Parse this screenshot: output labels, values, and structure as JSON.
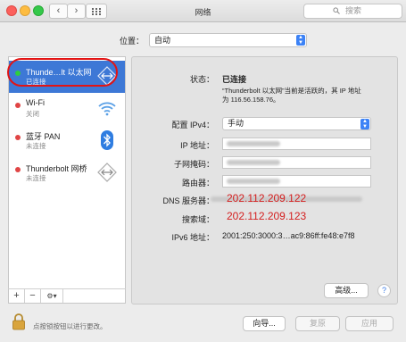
{
  "window": {
    "title": "网络"
  },
  "toolbar": {
    "back_glyph": "‹",
    "forward_glyph": "›",
    "search_placeholder": "搜索",
    "search_icon_glyph": "🔍"
  },
  "location": {
    "label": "位置：",
    "value": "自动"
  },
  "services": [
    {
      "name": "Thunde…lt 以太网",
      "status": "已连接",
      "dot_color": "#2ecc40",
      "icon": "ethernet-icon",
      "selected": true
    },
    {
      "name": "Wi-Fi",
      "status": "关闭",
      "dot_color": "#e04545",
      "icon": "wifi-icon",
      "selected": false
    },
    {
      "name": "蓝牙 PAN",
      "status": "未连接",
      "dot_color": "#e04545",
      "icon": "bluetooth-icon",
      "selected": false
    },
    {
      "name": "Thunderbolt 网桥",
      "status": "未连接",
      "dot_color": "#e04545",
      "icon": "ethernet-icon",
      "selected": false
    }
  ],
  "sidebar_actions": {
    "add": "+",
    "remove": "−",
    "gear": "⚙▾"
  },
  "detail": {
    "status_label": "状态：",
    "status_value": "已连接",
    "status_desc_1": "“Thunderbolt 以太网”当前是活跃的，其 IP 地址",
    "status_desc_2": "为 116.56.158.76。",
    "config_label": "配置 IPv4：",
    "config_value": "手动",
    "ip_label": "IP 地址：",
    "subnet_label": "子网掩码：",
    "router_label": "路由器：",
    "dns_label": "DNS 服务器：",
    "dns_value": "202.112.209.122",
    "search_domain_label": "搜索域：",
    "search_domain_value": "202.112.209.123",
    "ipv6_label": "IPv6 地址：",
    "ipv6_value": "2001:250:3000:3…ac9:86ff:fe48:e7f8",
    "advanced_button": "高级...",
    "help_glyph": "?"
  },
  "footer": {
    "lock_text": "点按锁按钮以进行更改。",
    "assist_button": "向导...",
    "revert_button": "复原",
    "apply_button": "应用"
  },
  "colors": {
    "accent": "#3d78d6",
    "highlight_red": "#e21414",
    "annotation_red": "#d42020"
  }
}
